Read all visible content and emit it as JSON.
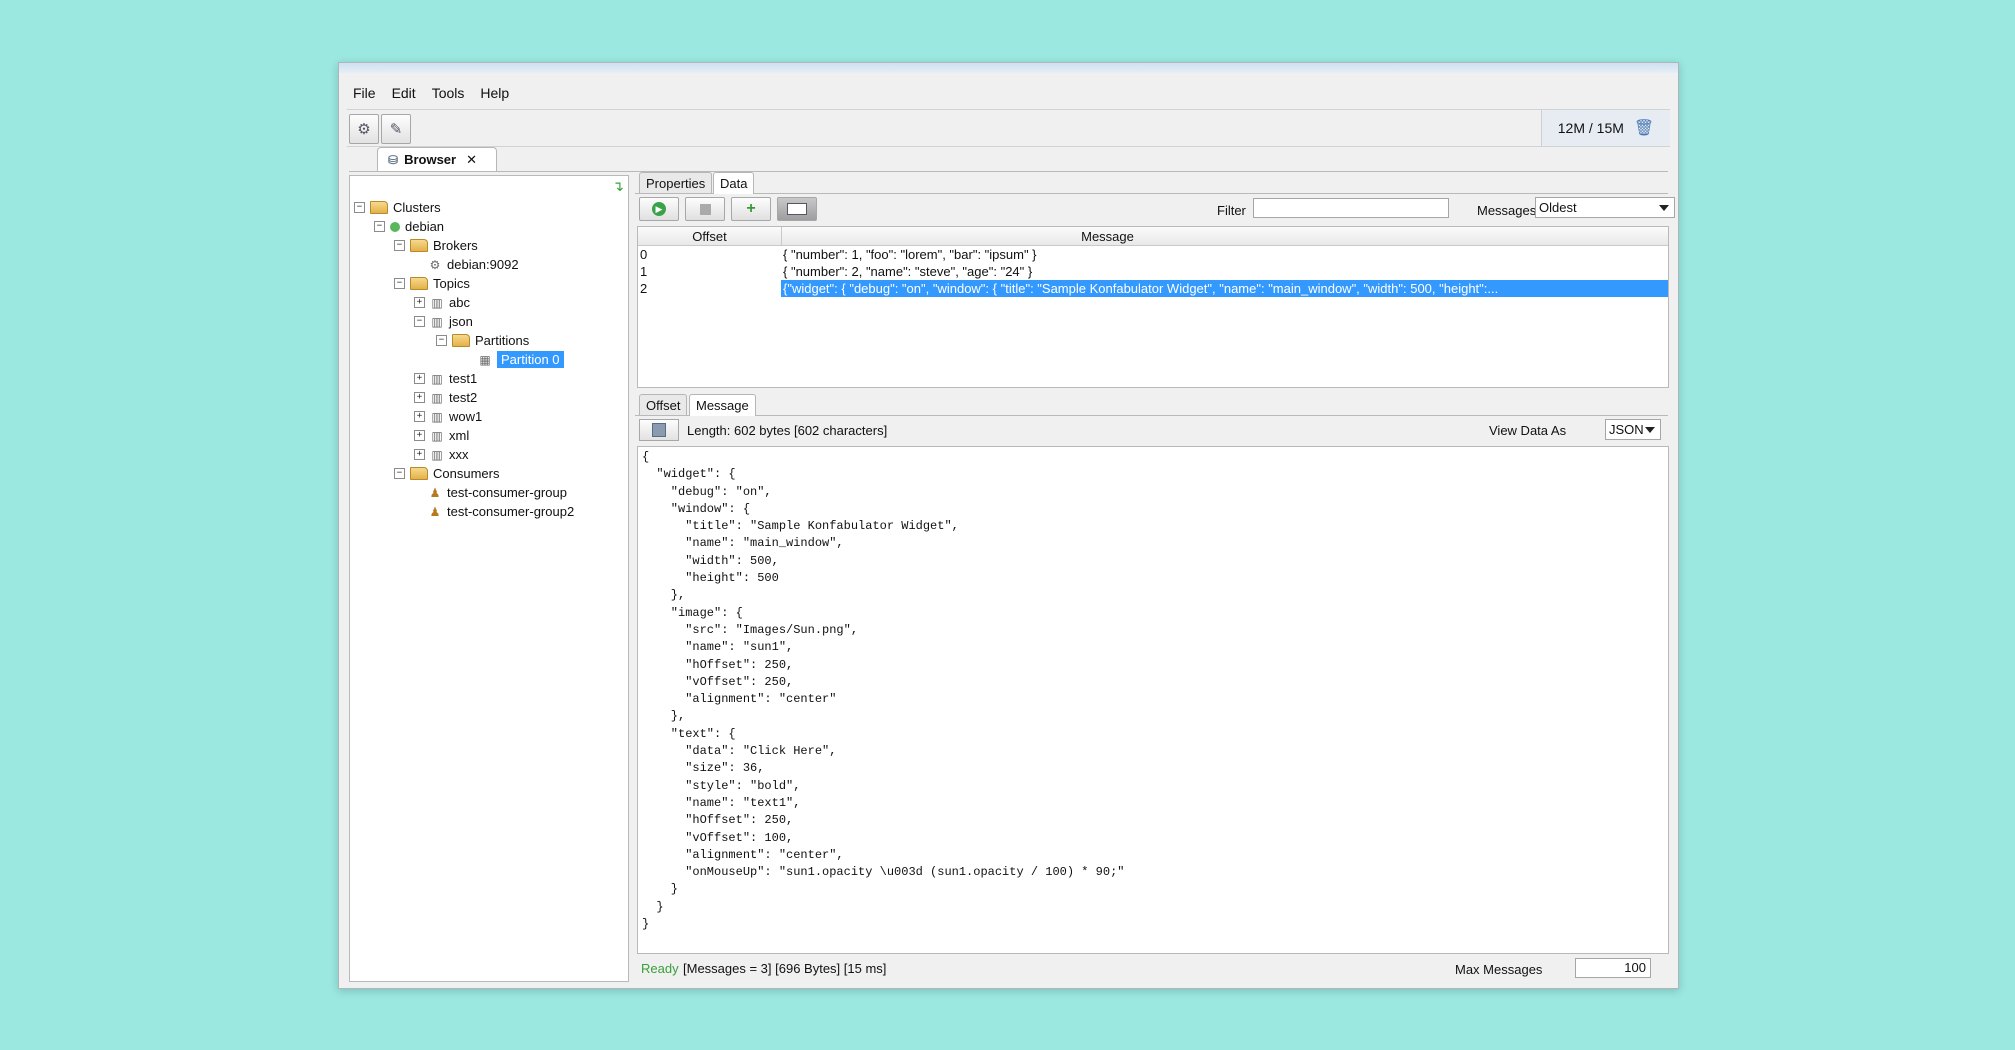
{
  "menu": [
    "File",
    "Edit",
    "Tools",
    "Help"
  ],
  "toolbar": {
    "memory": "12M / 15M",
    "icons": [
      "connect-cluster-icon",
      "settings-icon",
      "trash-icon"
    ]
  },
  "tabs": {
    "browser": {
      "label": "Browser",
      "close": "✕"
    }
  },
  "tree": {
    "root": "Clusters",
    "cluster": "debian",
    "brokers_label": "Brokers",
    "broker": "debian:9092",
    "topics_label": "Topics",
    "topics": [
      "abc",
      "json",
      "test1",
      "test2",
      "wow1",
      "xml",
      "xxx"
    ],
    "partitions_label": "Partitions",
    "partition": "Partition 0",
    "consumers_label": "Consumers",
    "consumers": [
      "test-consumer-group",
      "test-consumer-group2"
    ]
  },
  "data_panel": {
    "tabs": [
      "Properties",
      "Data"
    ],
    "filter_label": "Filter",
    "filter_value": "",
    "messages_label": "Messages",
    "messages_option": "Oldest"
  },
  "table": {
    "headers": [
      "Offset",
      "Message"
    ],
    "rows": [
      {
        "offset": "0",
        "message": "{ \"number\": 1, \"foo\": \"lorem\", \"bar\": \"ipsum\" }"
      },
      {
        "offset": "1",
        "message": "{ \"number\": 2, \"name\": \"steve\", \"age\": \"24\" }"
      },
      {
        "offset": "2",
        "message": "{\"widget\": {    \"debug\": \"on\",    \"window\": {        \"title\": \"Sample Konfabulator Widget\",        \"name\": \"main_window\",        \"width\": 500,        \"height\":..."
      }
    ],
    "selected_row": 2
  },
  "detail": {
    "tabs": [
      "Offset",
      "Message"
    ],
    "length_label": "Length: 602 bytes [602 characters]",
    "view_as_label": "View Data As",
    "view_as_value": "JSON",
    "json_text": "{\n  \"widget\": {\n    \"debug\": \"on\",\n    \"window\": {\n      \"title\": \"Sample Konfabulator Widget\",\n      \"name\": \"main_window\",\n      \"width\": 500,\n      \"height\": 500\n    },\n    \"image\": {\n      \"src\": \"Images/Sun.png\",\n      \"name\": \"sun1\",\n      \"hOffset\": 250,\n      \"vOffset\": 250,\n      \"alignment\": \"center\"\n    },\n    \"text\": {\n      \"data\": \"Click Here\",\n      \"size\": 36,\n      \"style\": \"bold\",\n      \"name\": \"text1\",\n      \"hOffset\": 250,\n      \"vOffset\": 100,\n      \"alignment\": \"center\",\n      \"onMouseUp\": \"sun1.opacity \\u003d (sun1.opacity / 100) * 90;\"\n    }\n  }\n}"
  },
  "status": {
    "ready": "Ready",
    "info": "[Messages = 3]  [696 Bytes]  [15 ms]",
    "max_label": "Max Messages",
    "max_value": "100"
  }
}
